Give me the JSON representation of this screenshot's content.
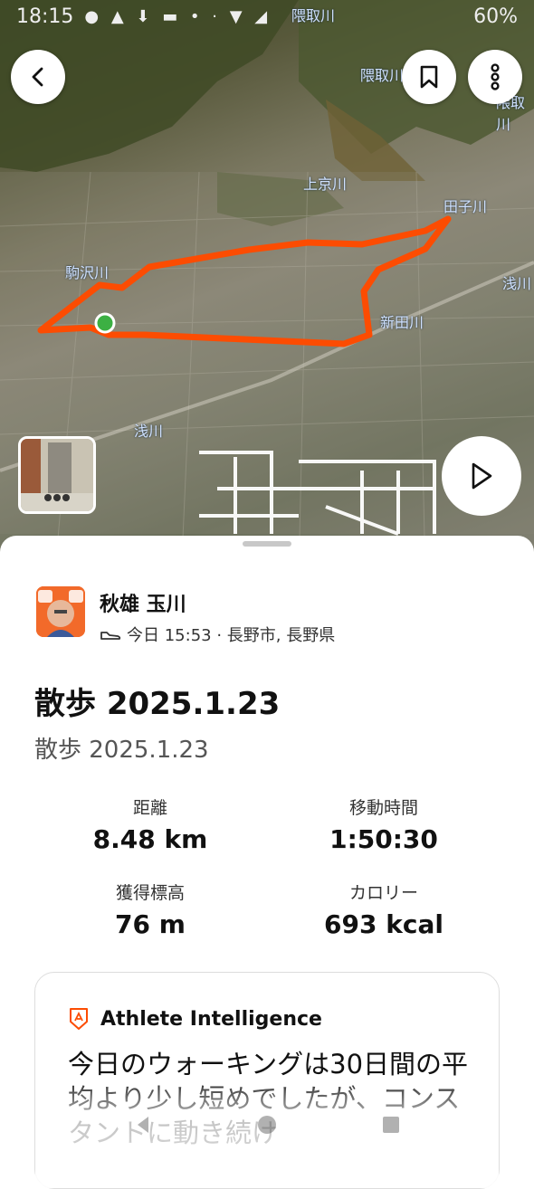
{
  "status_bar": {
    "time": "18:15",
    "battery": "60%"
  },
  "map": {
    "rivers": [
      "隈取川",
      "隈取川",
      "上京川",
      "田子川",
      "駒沢川",
      "浅川",
      "新田川",
      "浅川",
      "隈取川"
    ],
    "route_color": "#fc4c02",
    "start_marker_color": "#3cb043"
  },
  "top_buttons": {
    "back_icon": "chevron-left-icon",
    "bookmark_icon": "bookmark-icon",
    "more_icon": "more-vert-icon"
  },
  "activity": {
    "athlete_name": "秋雄 玉川",
    "meta_line": "今日 15:53 · 長野市, 長野県",
    "title": "散歩 2025.1.23",
    "description": "散歩 2025.1.23"
  },
  "stats": [
    {
      "label": "距離",
      "value": "8.48 km"
    },
    {
      "label": "移動時間",
      "value": "1:50:30"
    },
    {
      "label": "獲得標高",
      "value": "76 m"
    },
    {
      "label": "カロリー",
      "value": "693 kcal"
    }
  ],
  "athlete_intelligence": {
    "title": "Athlete Intelligence",
    "text": "今日のウォーキングは30日間の平均より少し短めでしたが、コンスタントに動き続け"
  }
}
